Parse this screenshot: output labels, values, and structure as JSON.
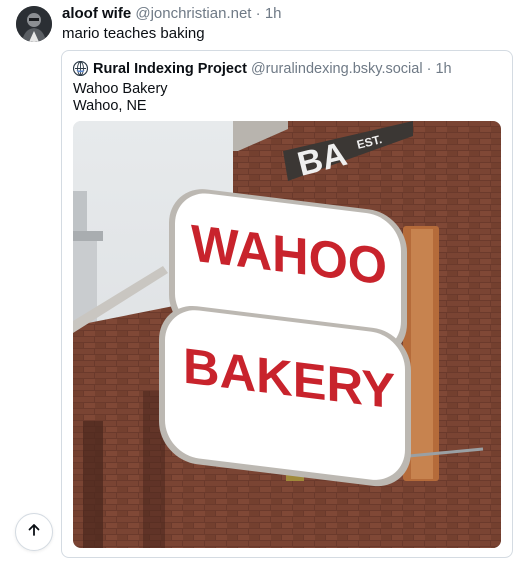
{
  "post": {
    "author_name": "aloof wife",
    "author_handle": "@jonchristian.net",
    "separator": "·",
    "time": "1h",
    "text": "mario teaches baking"
  },
  "quote": {
    "author_name": "Rural Indexing Project",
    "author_handle": "@ruralindexing.bsky.social",
    "separator": "·",
    "time": "1h",
    "line1": "Wahoo Bakery",
    "line2": "Wahoo, NE",
    "image": {
      "sign_top_text": "WAHOO",
      "sign_bottom_text": "BAKERY",
      "awning_text": "BA",
      "awning_small_text": "EST."
    }
  },
  "icons": {
    "scroll_top": "arrow-up-icon",
    "quote_avatar": "globe-icon"
  },
  "colors": {
    "sign_red": "#c8232c",
    "brick": "#6b3a2c",
    "handle_gray": "#6f7a86"
  }
}
